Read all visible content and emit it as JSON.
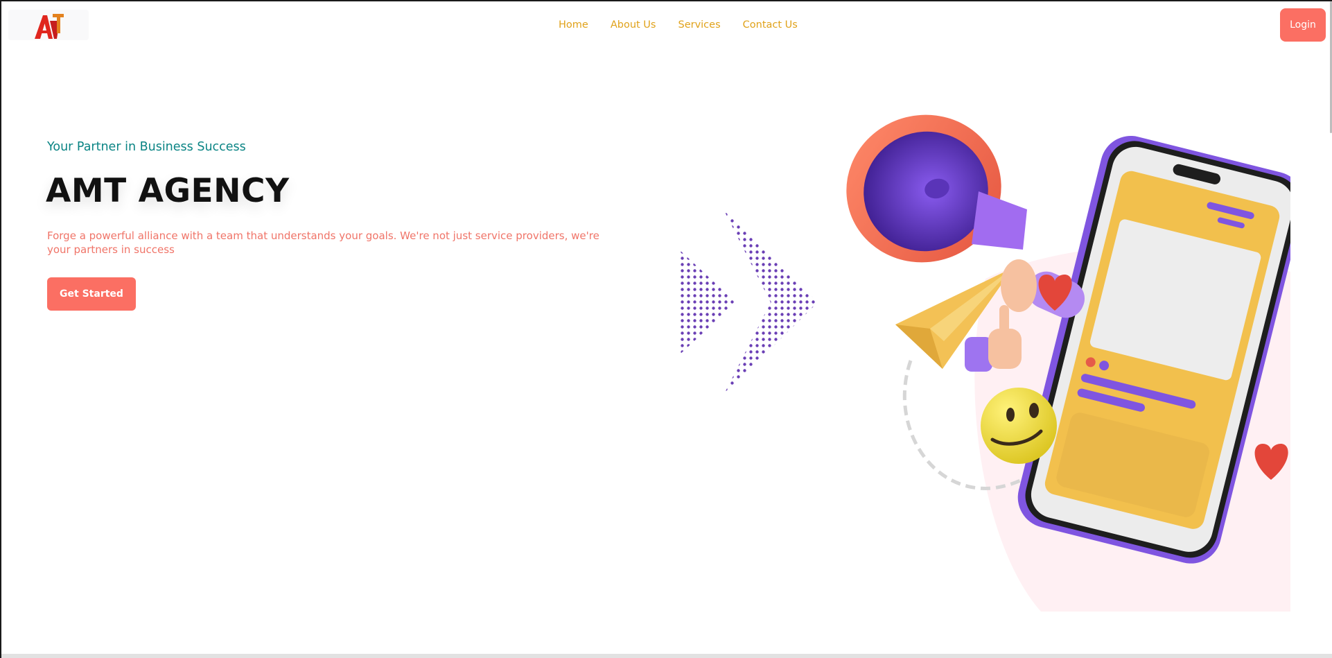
{
  "brand": {
    "logo_text": "AMT"
  },
  "nav": {
    "items": [
      "Home",
      "About Us",
      "Services",
      "Contact Us"
    ],
    "login_label": "Login"
  },
  "hero": {
    "tagline": "Your Partner in Business Success",
    "title": "AMT AGENCY",
    "description": "Forge a powerful alliance with a team that understands your goals. We're not just service providers, we're your partners in success",
    "cta_label": "Get Started"
  },
  "colors": {
    "accent": "#fb6f63",
    "nav_link": "#e0a21a",
    "tagline": "#0a8484",
    "description": "#f07468",
    "purple": "#7f55e0",
    "yellow": "#f2c04d"
  }
}
